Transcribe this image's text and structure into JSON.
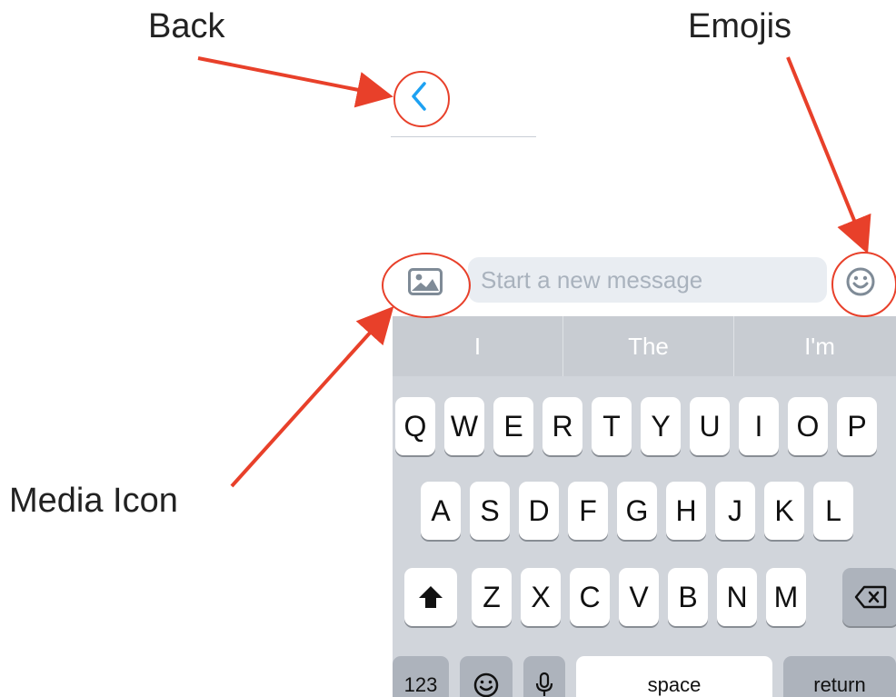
{
  "annotations": {
    "back": "Back",
    "emojis": "Emojis",
    "media": "Media Icon"
  },
  "composer": {
    "placeholder": "Start a new message"
  },
  "predictions": [
    "I",
    "The",
    "I'm"
  ],
  "keyboard": {
    "row1": [
      "Q",
      "W",
      "E",
      "R",
      "T",
      "Y",
      "U",
      "I",
      "O",
      "P"
    ],
    "row2": [
      "A",
      "S",
      "D",
      "F",
      "G",
      "H",
      "J",
      "K",
      "L"
    ],
    "row3": [
      "Z",
      "X",
      "C",
      "V",
      "B",
      "N",
      "M"
    ],
    "numbers_label": "123",
    "space_label": "space",
    "return_label": "return"
  },
  "colors": {
    "accent": "#1da1f2",
    "annotation": "#e8402a",
    "keyboard_bg": "#d1d5db"
  },
  "icons": {
    "back": "chevron-left-icon",
    "media": "image-icon",
    "emoji": "smiley-icon",
    "shift": "shift-arrow-icon",
    "delete": "backspace-icon",
    "keyboard_emoji": "smiley-icon",
    "mic": "microphone-icon"
  }
}
